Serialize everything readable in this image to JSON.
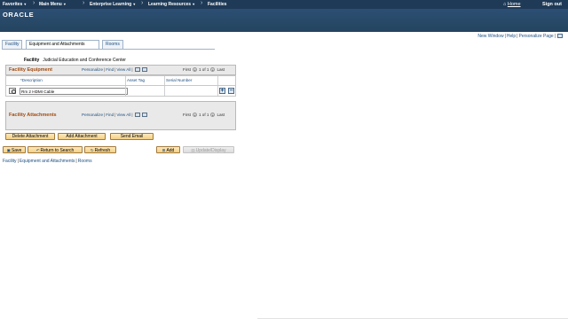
{
  "topnav": {
    "favorites": "Favorites",
    "main_menu": "Main Menu",
    "enterprise_learning": "Enterprise Learning",
    "learning_resources": "Learning Resources",
    "facilities": "Facilities",
    "home": "Home",
    "sign_out": "Sign out"
  },
  "brand": {
    "logo": "ORACLE"
  },
  "util_links": {
    "new_window": "New Window",
    "help": "Help",
    "personalize_page": "Personalize Page"
  },
  "tabs": [
    {
      "label": "Facility",
      "active": false
    },
    {
      "label": "Equipment and Attachments",
      "active": true
    },
    {
      "label": "Rooms",
      "active": false
    }
  ],
  "facility": {
    "label": "Facility",
    "value": "Judicial Education and Conference Center"
  },
  "equipment_grid": {
    "title": "Facility Equipment",
    "personalize": "Personalize",
    "find": "Find",
    "view_all": "View All",
    "first": "First",
    "range": "1 of 1",
    "last": "Last",
    "columns": [
      "*Description",
      "Asset Tag",
      "Serial Number"
    ],
    "rows": [
      {
        "description": "Rm 2 HDMI Cable",
        "asset_tag": "",
        "serial_number": ""
      }
    ],
    "add_row": "+",
    "delete_row": "−"
  },
  "attachments_grid": {
    "title": "Facility Attachments",
    "personalize": "Personalize",
    "find": "Find",
    "view_all": "View All",
    "first": "First",
    "range": "1 of 1",
    "last": "Last"
  },
  "attachment_buttons": {
    "delete": "Delete Attachment",
    "add": "Add Attachment",
    "email": "Send Email"
  },
  "toolbar": {
    "save": "Save",
    "return": "Return to Search",
    "refresh": "Refresh",
    "add": "Add",
    "update_display": "Update/Display"
  },
  "bottom_links": {
    "facility": "Facility",
    "equipment": "Equipment and Attachments",
    "rooms": "Rooms"
  },
  "colors": {
    "nav_bg": "#1e3a57",
    "banner": "#2c4f73",
    "grid_title": "#a24b10",
    "link": "#1c4e80",
    "button": "#f4cf84"
  }
}
